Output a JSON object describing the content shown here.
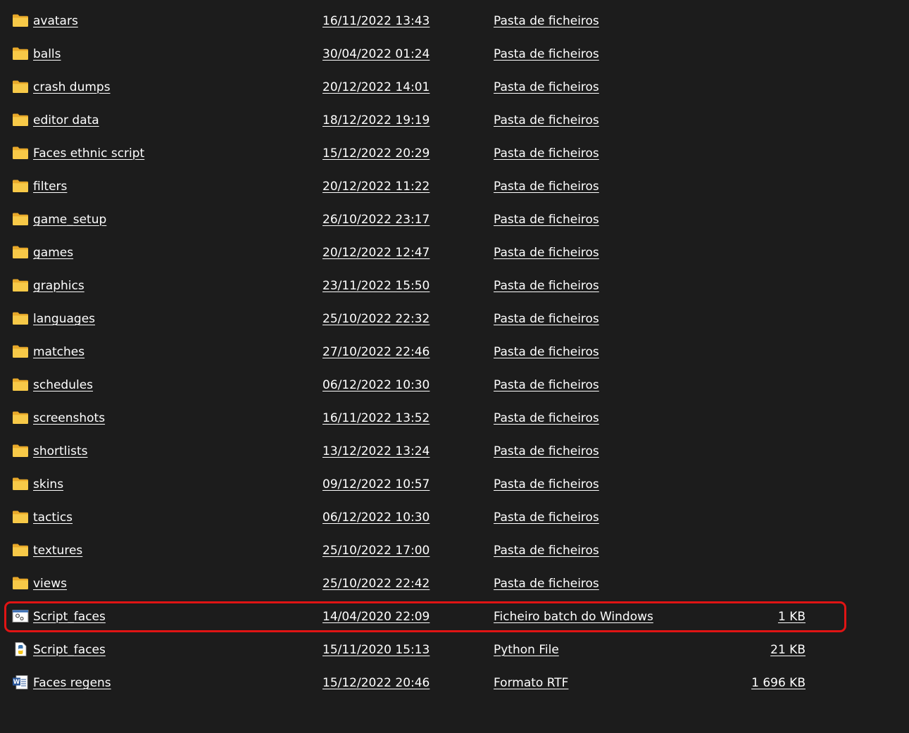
{
  "files": [
    {
      "name": "avatars",
      "date": "16/11/2022 13:43",
      "type": "Pasta de ficheiros",
      "size": "",
      "icon": "folder-icon"
    },
    {
      "name": "balls",
      "date": "30/04/2022 01:24",
      "type": "Pasta de ficheiros",
      "size": "",
      "icon": "folder-icon"
    },
    {
      "name": "crash dumps",
      "date": "20/12/2022 14:01",
      "type": "Pasta de ficheiros",
      "size": "",
      "icon": "folder-icon"
    },
    {
      "name": "editor data",
      "date": "18/12/2022 19:19",
      "type": "Pasta de ficheiros",
      "size": "",
      "icon": "folder-icon"
    },
    {
      "name": "Faces ethnic script",
      "date": "15/12/2022 20:29",
      "type": "Pasta de ficheiros",
      "size": "",
      "icon": "folder-icon"
    },
    {
      "name": "filters",
      "date": "20/12/2022 11:22",
      "type": "Pasta de ficheiros",
      "size": "",
      "icon": "folder-icon"
    },
    {
      "name": "game_setup",
      "date": "26/10/2022 23:17",
      "type": "Pasta de ficheiros",
      "size": "",
      "icon": "folder-icon"
    },
    {
      "name": "games",
      "date": "20/12/2022 12:47",
      "type": "Pasta de ficheiros",
      "size": "",
      "icon": "folder-icon"
    },
    {
      "name": "graphics",
      "date": "23/11/2022 15:50",
      "type": "Pasta de ficheiros",
      "size": "",
      "icon": "folder-icon"
    },
    {
      "name": "languages",
      "date": "25/10/2022 22:32",
      "type": "Pasta de ficheiros",
      "size": "",
      "icon": "folder-icon"
    },
    {
      "name": "matches",
      "date": "27/10/2022 22:46",
      "type": "Pasta de ficheiros",
      "size": "",
      "icon": "folder-icon"
    },
    {
      "name": "schedules",
      "date": "06/12/2022 10:30",
      "type": "Pasta de ficheiros",
      "size": "",
      "icon": "folder-icon"
    },
    {
      "name": "screenshots",
      "date": "16/11/2022 13:52",
      "type": "Pasta de ficheiros",
      "size": "",
      "icon": "folder-icon"
    },
    {
      "name": "shortlists",
      "date": "13/12/2022 13:24",
      "type": "Pasta de ficheiros",
      "size": "",
      "icon": "folder-icon"
    },
    {
      "name": "skins",
      "date": "09/12/2022 10:57",
      "type": "Pasta de ficheiros",
      "size": "",
      "icon": "folder-icon"
    },
    {
      "name": "tactics",
      "date": "06/12/2022 10:30",
      "type": "Pasta de ficheiros",
      "size": "",
      "icon": "folder-icon"
    },
    {
      "name": "textures",
      "date": "25/10/2022 17:00",
      "type": "Pasta de ficheiros",
      "size": "",
      "icon": "folder-icon"
    },
    {
      "name": "views",
      "date": "25/10/2022 22:42",
      "type": "Pasta de ficheiros",
      "size": "",
      "icon": "folder-icon"
    },
    {
      "name": "Script_faces",
      "date": "14/04/2020 22:09",
      "type": "Ficheiro batch do Windows",
      "size": "1 KB",
      "icon": "batch-file-icon"
    },
    {
      "name": "Script_faces",
      "date": "15/11/2020 15:13",
      "type": "Python File",
      "size": "21 KB",
      "icon": "python-file-icon"
    },
    {
      "name": "Faces regens",
      "date": "15/12/2022 20:46",
      "type": "Formato RTF",
      "size": "1 696 KB",
      "icon": "word-document-icon"
    }
  ],
  "highlight_color": "#e01414",
  "background_color": "#1c1c1c",
  "folder_color": "#f7c948"
}
